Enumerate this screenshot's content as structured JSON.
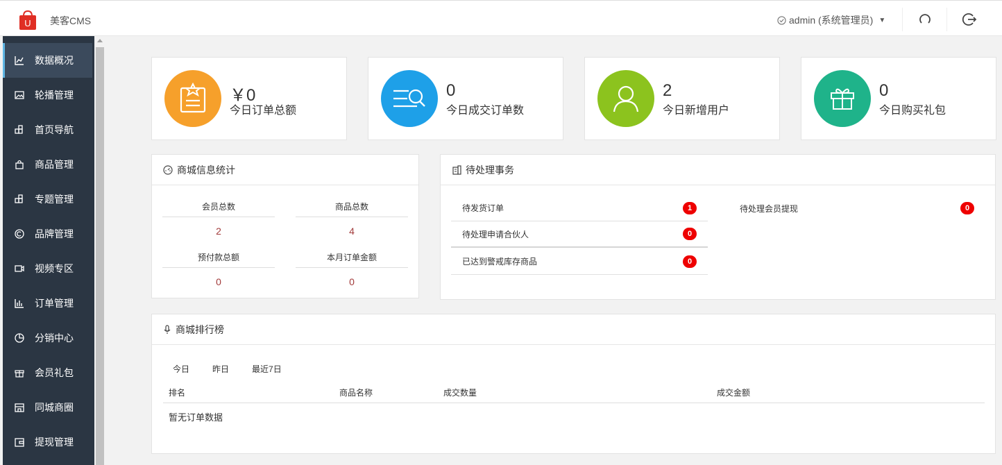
{
  "header": {
    "app_title": "美客CMS",
    "user_label": "admin (系统管理员)",
    "colors": {
      "logo": "#e02e24"
    }
  },
  "sidebar": {
    "items": [
      {
        "label": "数据概况",
        "icon": "line-chart-icon",
        "active": true
      },
      {
        "label": "轮播管理",
        "icon": "image-icon"
      },
      {
        "label": "首页导航",
        "icon": "nav-icon"
      },
      {
        "label": "商品管理",
        "icon": "bag-icon"
      },
      {
        "label": "专题管理",
        "icon": "topic-icon"
      },
      {
        "label": "品牌管理",
        "icon": "copyright-icon"
      },
      {
        "label": "视频专区",
        "icon": "video-icon"
      },
      {
        "label": "订单管理",
        "icon": "bar-chart-icon"
      },
      {
        "label": "分销中心",
        "icon": "pie-icon"
      },
      {
        "label": "会员礼包",
        "icon": "gift-icon"
      },
      {
        "label": "同城商圈",
        "icon": "store-icon"
      },
      {
        "label": "提现管理",
        "icon": "wallet-icon"
      }
    ]
  },
  "stats": [
    {
      "value": "￥0",
      "label": "今日订单总额",
      "color": "#f6a02b",
      "icon": "order-clipboard-icon"
    },
    {
      "value": "0",
      "label": "今日成交订单数",
      "color": "#1ea0e8",
      "icon": "search-list-icon"
    },
    {
      "value": "2",
      "label": "今日新增用户",
      "color": "#8cc31e",
      "icon": "user-icon"
    },
    {
      "value": "0",
      "label": "今日购买礼包",
      "color": "#1fb38a",
      "icon": "gift-icon"
    }
  ],
  "info": {
    "title": "商城信息统计",
    "cells": [
      {
        "key": "会员总数",
        "value": "2"
      },
      {
        "key": "商品总数",
        "value": "4"
      },
      {
        "key": "预付款总额",
        "value": "0"
      },
      {
        "key": "本月订单金额",
        "value": "0"
      }
    ]
  },
  "todo": {
    "title": "待处理事务",
    "items": [
      {
        "label": "待发货订单",
        "count": "1"
      },
      {
        "label": "待处理申请合伙人",
        "count": "0"
      },
      {
        "label": "已达到警戒库存商品",
        "count": "0"
      },
      {
        "label": "待处理会员提现",
        "count": "0"
      }
    ]
  },
  "ranking": {
    "title": "商城排行榜",
    "tabs": [
      "今日",
      "昨日",
      "最近7日"
    ],
    "columns": [
      "排名",
      "商品名称",
      "成交数量",
      "成交金额"
    ],
    "empty_text": "暂无订单数据"
  }
}
